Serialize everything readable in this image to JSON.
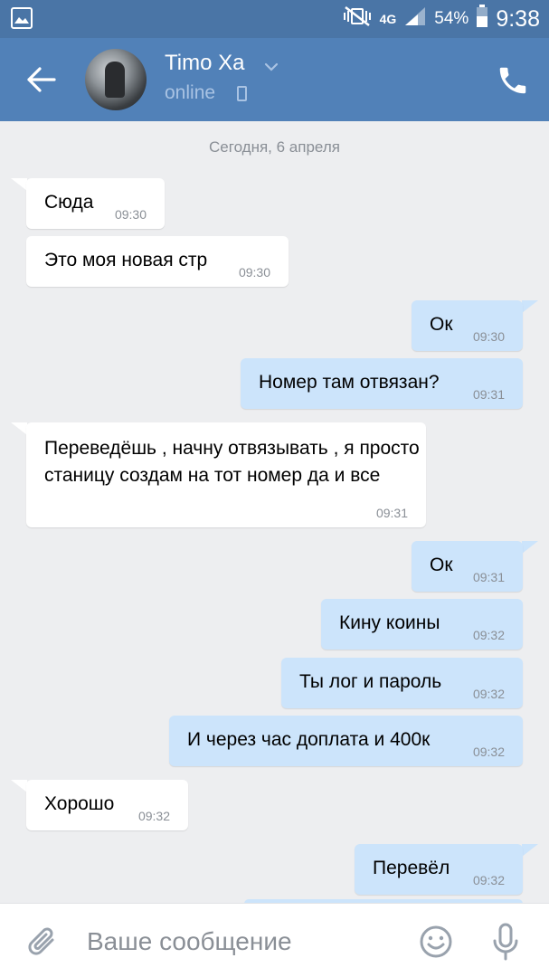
{
  "status_bar": {
    "network": "4G",
    "battery": "54%",
    "time": "9:38"
  },
  "header": {
    "contact_name": "Timo Xa",
    "contact_status": "online"
  },
  "chat": {
    "date_separator": "Сегодня, 6 апреля",
    "messages": [
      {
        "direction": "in",
        "text": "Сюда",
        "time": "09:30"
      },
      {
        "direction": "in",
        "text": "Это моя новая стр",
        "time": "09:30"
      },
      {
        "direction": "out",
        "text": "Ок",
        "time": "09:30"
      },
      {
        "direction": "out",
        "text": "Номер там отвязан?",
        "time": "09:31"
      },
      {
        "direction": "in",
        "text": "Переведёшь , начну отвязывать , я просто станицу создам на тот номер да и все",
        "time": "09:31"
      },
      {
        "direction": "out",
        "text": "Ок",
        "time": "09:31"
      },
      {
        "direction": "out",
        "text": "Кину коины",
        "time": "09:32"
      },
      {
        "direction": "out",
        "text": "Ты лог и пароль",
        "time": "09:32"
      },
      {
        "direction": "out",
        "text": "И через час доплата и 400к",
        "time": "09:32"
      },
      {
        "direction": "in",
        "text": "Хорошо",
        "time": "09:32"
      },
      {
        "direction": "out",
        "text": "Перевёл",
        "time": "09:32"
      }
    ]
  },
  "composer": {
    "placeholder": "Ваше сообщение"
  },
  "colors": {
    "header_bg": "#5181b8",
    "status_bar_bg": "#4a75a6",
    "chat_bg": "#edeef0",
    "incoming_bubble": "#ffffff",
    "outgoing_bubble": "#cce4fb",
    "icon_gray": "#99a2ad"
  }
}
